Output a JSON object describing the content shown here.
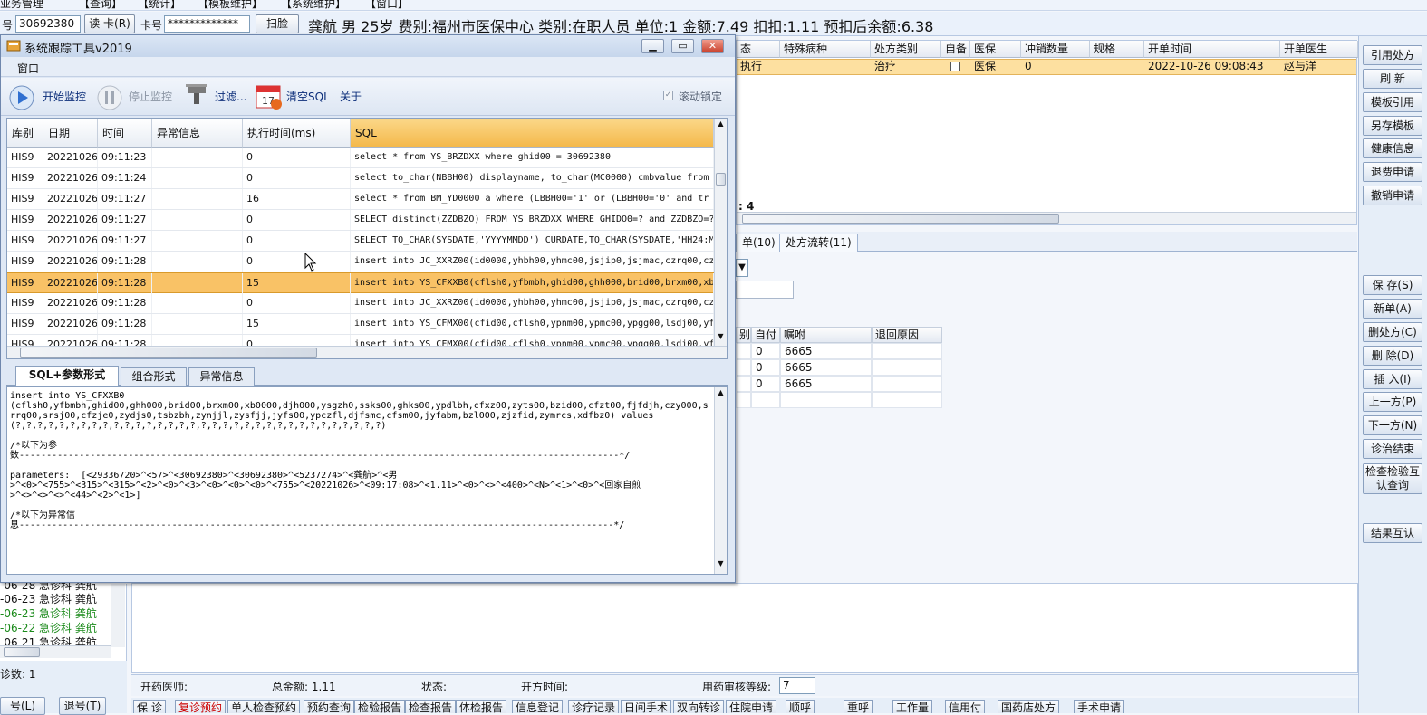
{
  "menubar": [
    "业务管理",
    "【查询】",
    "【统计】",
    "【模板维护】",
    "【系统维护】",
    "【窗口】"
  ],
  "patient_bar": {
    "id_label": "号",
    "id_value": "30692380",
    "read_card_button": "读 卡(R)",
    "card_label": "卡号",
    "card_value": "*************",
    "scan_button": "扫脸",
    "summary": "龚航 男 25岁 费别:福州市医保中心 类别:在职人员 单位:1 金额:7.49 扣扣:1.11 预扣后余额:6.38"
  },
  "right_buttons": [
    "引用处方",
    "刷 新",
    "模板引用",
    "另存模板",
    "健康信息",
    "退费申请",
    "撤销申请",
    "保 存(S)",
    "新单(A)",
    "删处方(C)",
    "删 除(D)",
    "插 入(I)",
    "上一方(P)",
    "下一方(N)",
    "诊治结束",
    "检查检验互认查询",
    "结果互认"
  ],
  "bg_grid": {
    "headers": [
      "态",
      "特殊病种",
      "处方类别",
      "自备",
      "医保",
      "冲销数量",
      "规格",
      "开单时间",
      "开单医生"
    ],
    "row": {
      "c0": "执行",
      "c1": "",
      "c2": "治疗",
      "c3": "",
      "c4": "医保",
      "c5": "0",
      "c6": "",
      "c7": "2022-10-26 09:08:43",
      "c8": "赵与洋"
    },
    "footer_fragment": ": 4"
  },
  "bg_tabs": [
    "单(10)",
    "处方流转(11)"
  ],
  "bg_grid2": {
    "headers": [
      "别",
      "自付",
      "嘱咐",
      "退回原因"
    ],
    "rows": [
      {
        "a": "",
        "b": "0",
        "c": "6665",
        "d": ""
      },
      {
        "a": "",
        "b": "0",
        "c": "6665",
        "d": ""
      },
      {
        "a": "",
        "b": "0",
        "c": "6665",
        "d": ""
      }
    ]
  },
  "left_list": [
    {
      "date": "-06-28",
      "dept": "急诊科",
      "name": "龚航",
      "color": "#111111"
    },
    {
      "date": "-06-23",
      "dept": "急诊科",
      "name": "龚航",
      "color": "#111111"
    },
    {
      "date": "-06-23",
      "dept": "急诊科",
      "name": "龚航",
      "color": "#1a8a1a"
    },
    {
      "date": "-06-22",
      "dept": "急诊科",
      "name": "龚航",
      "color": "#1a8a1a"
    },
    {
      "date": "-06-21",
      "dept": "急诊科",
      "name": "龚航",
      "color": "#111111"
    }
  ],
  "left_footer": {
    "count": "诊数: 1",
    "btn1": "号(L)",
    "btn2": "退号(T)"
  },
  "bottom_status": {
    "doctor": "开药医师:",
    "total": "总金额: 1.11",
    "status": "状态:",
    "time": "开方时间:",
    "level_label": "用药审核等级:",
    "level_value": "7"
  },
  "bottom_buttons": [
    "保 诊",
    "复诊预约",
    "单人检查预约",
    "预约查询",
    "检验报告",
    "检查报告",
    "体检报告",
    "信息登记",
    "诊疗记录",
    "日间手术",
    "双向转诊",
    "住院申请",
    "顺呼",
    "重呼",
    "工作量",
    "信用付",
    "国药店处方",
    "手术申请"
  ],
  "trace_window": {
    "title": "系统跟踪工具v2019",
    "menu": "窗口",
    "toolbar": {
      "start": "开始监控",
      "stop": "停止监控",
      "filter": "过滤...",
      "clear": "清空SQL",
      "about": "关于",
      "scroll_lock": "滚动锁定"
    },
    "columns": [
      "库别",
      "日期",
      "时间",
      "异常信息",
      "执行时间(ms)",
      "SQL"
    ],
    "rows": [
      {
        "db": "HIS9",
        "date": "20221026",
        "time": "09:11:23",
        "err": "",
        "ms": "0",
        "sql": "select * from YS_BRZDXX where ghid00 = 30692380",
        "sel": false
      },
      {
        "db": "HIS9",
        "date": "20221026",
        "time": "09:11:24",
        "err": "",
        "ms": "0",
        "sql": "select to_char(NBBH00)  displayname, to_char(MC0000)  cmbvalue from",
        "sel": false
      },
      {
        "db": "HIS9",
        "date": "20221026",
        "time": "09:11:27",
        "err": "",
        "ms": "16",
        "sql": " select * from BM_YD0000 a where (LBBH00='1' or (LBBH00='0' and tr",
        "sel": false
      },
      {
        "db": "HIS9",
        "date": "20221026",
        "time": "09:11:27",
        "err": "",
        "ms": "0",
        "sql": "SELECT distinct(ZZDBZO) FROM YS_BRZDXX WHERE GHIDO0=? and ZZDBZO=?",
        "sel": false
      },
      {
        "db": "HIS9",
        "date": "20221026",
        "time": "09:11:27",
        "err": "",
        "ms": "0",
        "sql": "SELECT TO_CHAR(SYSDATE,'YYYYMMDD') CURDATE,TO_CHAR(SYSDATE,'HH24:MI",
        "sel": false
      },
      {
        "db": "HIS9",
        "date": "20221026",
        "time": "09:11:28",
        "err": "",
        "ms": "0",
        "sql": "insert into JC_XXRZ00(id0000,yhbh00,yhmc00,jsjip0,jsjmac,czrq00,czs",
        "sel": false
      },
      {
        "db": "HIS9",
        "date": "20221026",
        "time": "09:11:28",
        "err": "",
        "ms": "15",
        "sql": "insert into YS_CFXXB0(cflsh0,yfbmbh,ghid00,ghh000,brid00,brxm00,xb0",
        "sel": true
      },
      {
        "db": "HIS9",
        "date": "20221026",
        "time": "09:11:28",
        "err": "",
        "ms": "0",
        "sql": "insert into JC_XXRZ00(id0000,yhbh00,yhmc00,jsjip0,jsjmac,czrq00,czs",
        "sel": false
      },
      {
        "db": "HIS9",
        "date": "20221026",
        "time": "09:11:28",
        "err": "",
        "ms": "15",
        "sql": "insert into YS_CFMX00(cfid00,cflsh0,ypnm00,ypmc00,ypgg00,lsdj00,yf",
        "sel": false
      },
      {
        "db": "HIS9",
        "date": "20221026",
        "time": "09:11:28",
        "err": "",
        "ms": "0",
        "sql": "insert into YS_CFMX00(cfid00,cflsh0,ypnm00,ypmc00,ypgg00,lsdj00,yf",
        "sel": false
      }
    ],
    "tabs": [
      "SQL+参数形式",
      "组合形式",
      "异常信息"
    ],
    "sql_text": "insert into YS_CFXXB0\n(cflsh0,yfbmbh,ghid00,ghh000,brid00,brxm00,xb0000,djh000,ysgzh0,ssks00,ghks00,ypdlbh,cfxz00,zyts00,bzid00,cfzt00,fjfdjh,czy000,srrq00,srsj00,cfzje0,zydjs0,tsbzbh,zynjjl,zysfjj,jyfs00,ypczfl,djfsmc,cfsm00,jyfabm,bzl000,zjzfid,zymrcs,xdfbz0) values\n(?,?,?,?,?,?,?,?,?,?,?,?,?,?,?,?,?,?,?,?,?,?,?,?,?,?,?,?,?,?,?,?,?,?)\n\n/*以下为参\n数--------------------------------------------------------------------------------------------------------------*/\n\nparameters:  [<29336720>^<57>^<30692380>^<30692380>^<5237274>^<龚航>^<男\n>^<0>^<755>^<315>^<315>^<2>^<0>^<3>^<0>^<0>^<0>^<755>^<20221026>^<09:17:08>^<1.11>^<0>^<>^<400>^<N>^<1>^<0>^<回家自煎\n>^<>^<>^<>^<44>^<2>^<1>]\n\n/*以下为异常信\n息-------------------------------------------------------------------------------------------------------------*/"
  },
  "colors": {
    "selection": "#f9c266",
    "accent": "#f4b94b",
    "window_title_bg": "#c6d6ec"
  }
}
